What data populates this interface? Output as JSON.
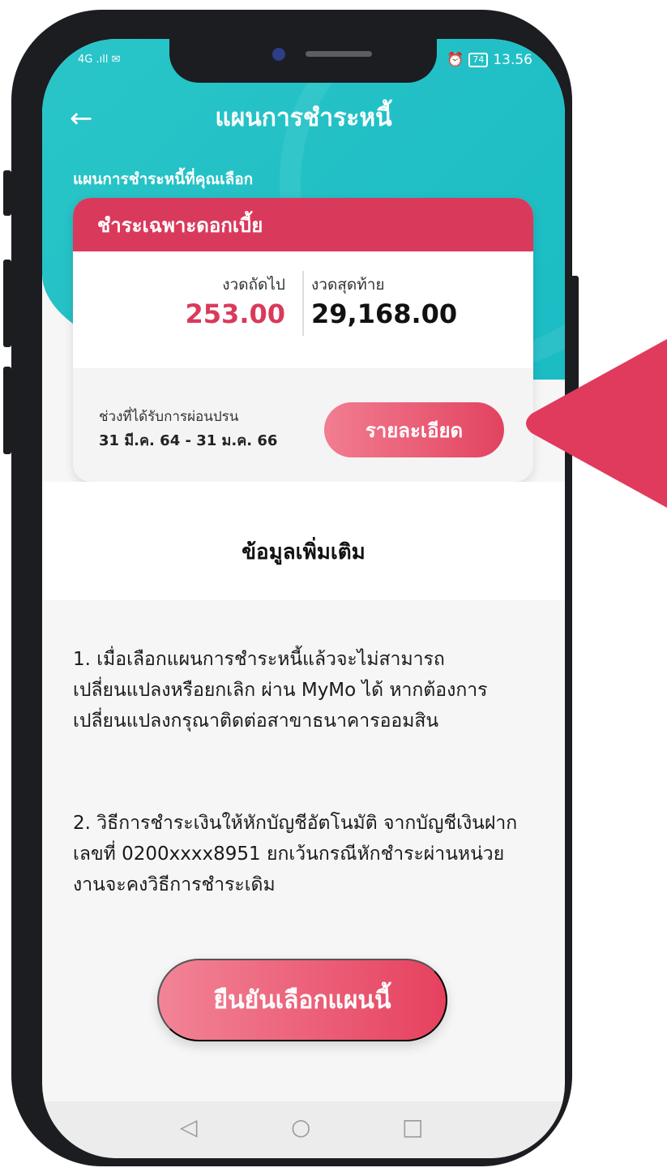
{
  "status_bar": {
    "left": "4G .ıll ✉",
    "time": "13.56",
    "battery": "74"
  },
  "header": {
    "back_icon": "arrow-left-icon",
    "title": "แผนการชำระหนี้"
  },
  "subtitle": "แผนการชำระหนี้ที่คุณเลือก",
  "plan_card": {
    "title": "ชำระเฉพาะดอกเบี้ย",
    "next_label": "งวดถัดไป",
    "next_amount": "253.00",
    "last_label": "งวดสุดท้าย",
    "last_amount": "29,168.00",
    "period_label": "ช่วงที่ได้รับการผ่อนปรน",
    "period_value": "31 มี.ค. 64 - 31 ม.ค. 66",
    "detail_button": "รายละเอียด"
  },
  "info": {
    "title": "ข้อมูลเพิ่มเติม",
    "note1": "1. เมื่อเลือกแผนการชำระหนี้แล้วจะไม่สามารถเปลี่ยนแปลงหรือยกเลิก ผ่าน MyMo ได้ หากต้องการเปลี่ยนแปลงกรุณาติดต่อสาขาธนาคารออมสิน",
    "note2": "2. วิธีการชำระเงินให้หักบัญชีอัตโนมัติ จากบัญชีเงินฝากเลขที่ 0200xxxx8951 ยกเว้นกรณีหักชำระผ่านหน่วยงานจะคงวิธีการชำระเดิม"
  },
  "confirm_button": "ยืนยันเลือกแผนนี้",
  "nav": {
    "back": "◁",
    "home": "○",
    "recent": "□"
  },
  "colors": {
    "teal": "#1bbcc4",
    "accent": "#d93a5c",
    "pointer": "#e03a5d"
  }
}
